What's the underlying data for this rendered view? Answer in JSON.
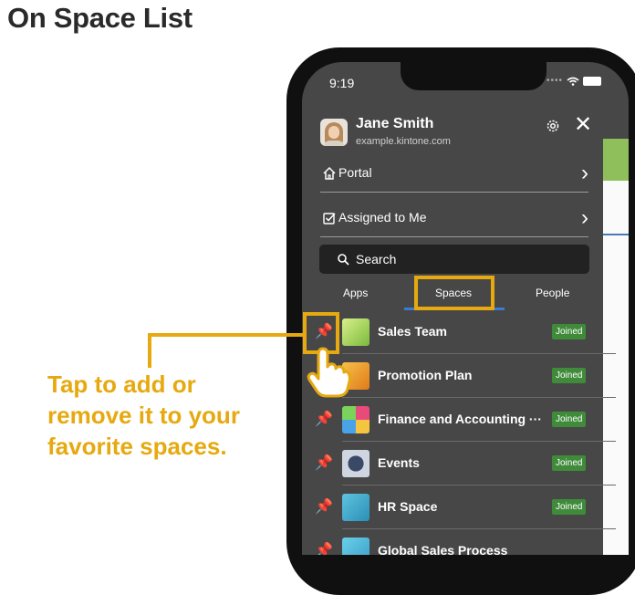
{
  "page_title": "On Space List",
  "status": {
    "time": "9:19"
  },
  "user": {
    "name": "Jane Smith",
    "domain": "example.kintone.com"
  },
  "nav": [
    {
      "label": "Portal",
      "icon": "home-icon"
    },
    {
      "label": "Assigned to Me",
      "icon": "checkbox-icon"
    }
  ],
  "search": {
    "label": "Search"
  },
  "tabs": [
    {
      "label": "Apps",
      "active": false
    },
    {
      "label": "Spaces",
      "active": true
    },
    {
      "label": "People",
      "active": false
    }
  ],
  "spaces": [
    {
      "name": "Sales Team",
      "badge": "Joined",
      "pinned": true
    },
    {
      "name": "Promotion Plan",
      "badge": "Joined",
      "pinned": true
    },
    {
      "name": "Finance and Accounting ···",
      "badge": "Joined",
      "pinned": false
    },
    {
      "name": "Events",
      "badge": "Joined",
      "pinned": false
    },
    {
      "name": "HR Space",
      "badge": "Joined",
      "pinned": false
    },
    {
      "name": "Global Sales Process",
      "badge": "",
      "pinned": false
    }
  ],
  "callout": {
    "line1": "Tap to add or",
    "line2": "remove it to your",
    "line3": "favorite spaces."
  },
  "colors": {
    "accent": "#e6a90f",
    "joined_badge": "#3f8b3a",
    "tab_underline": "#3b7bd6"
  }
}
